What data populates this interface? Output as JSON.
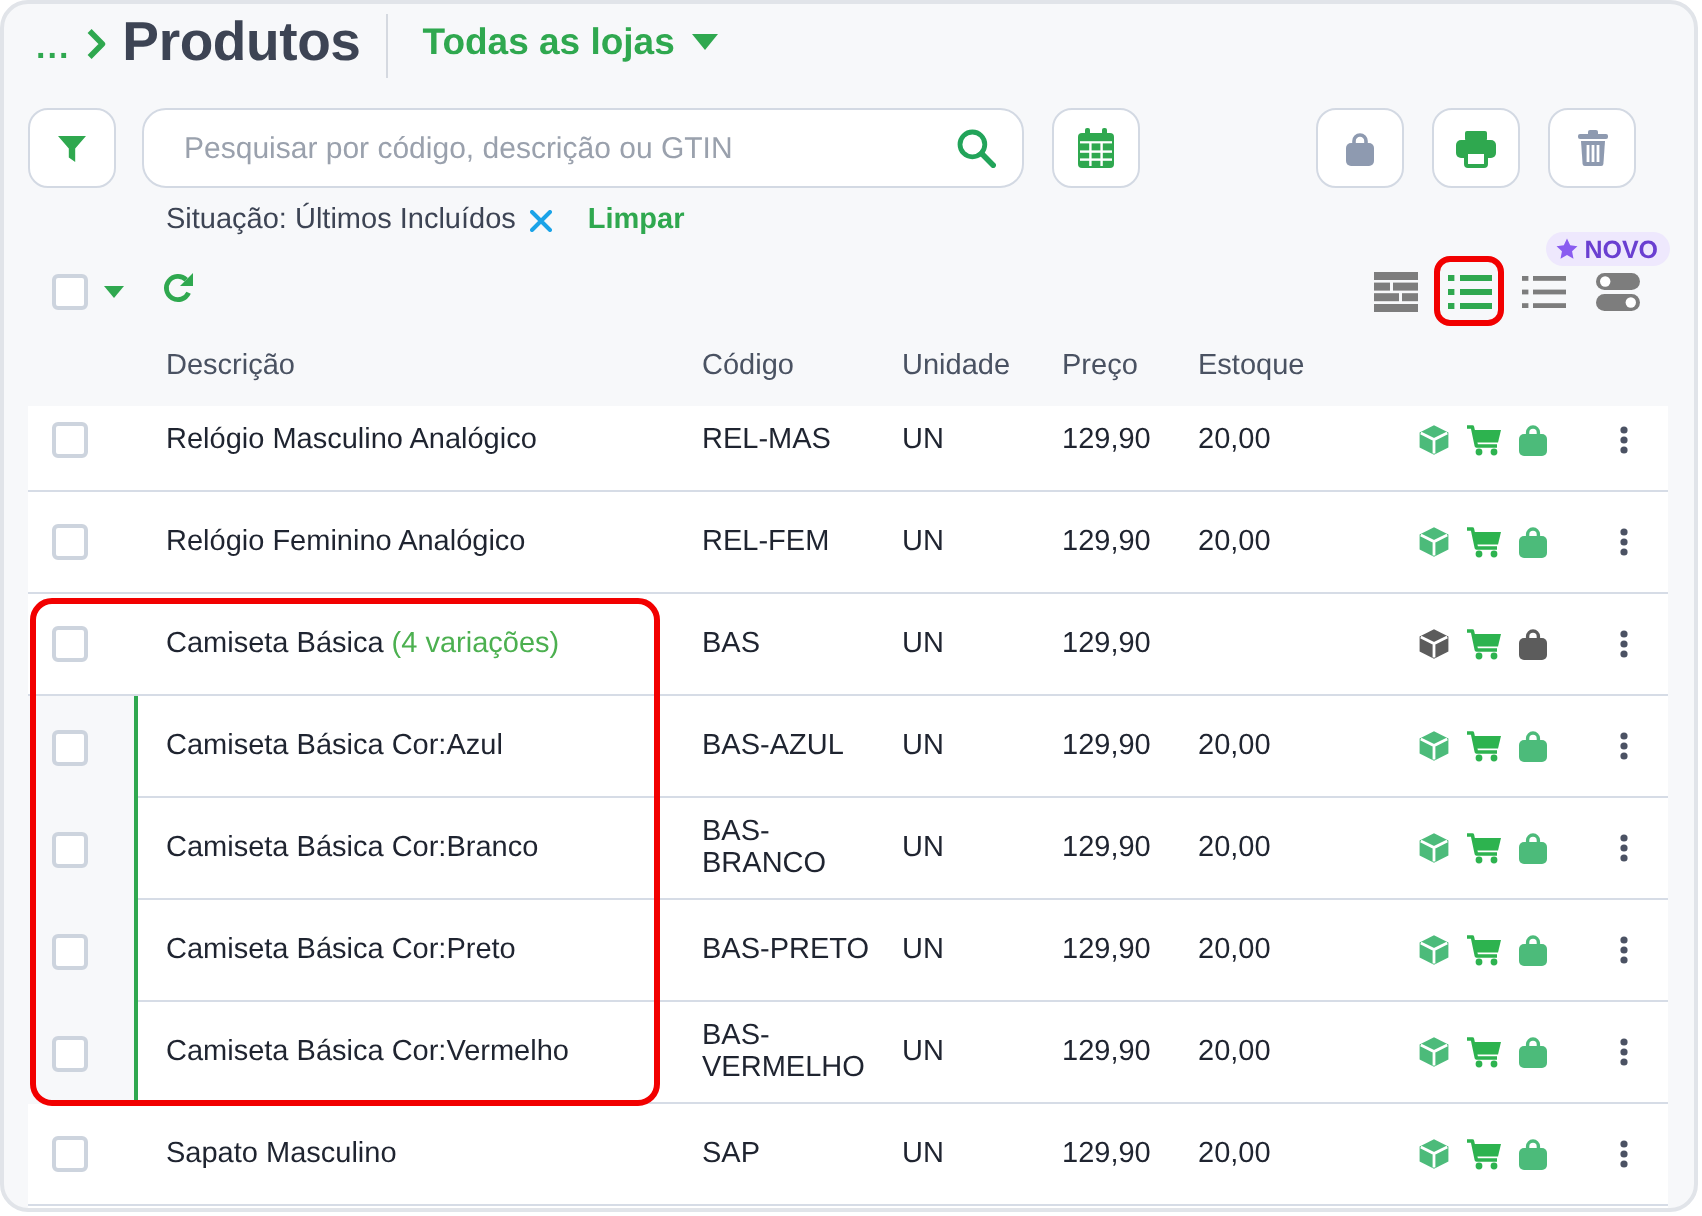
{
  "breadcrumb": {
    "ellipsis": "...",
    "title": "Produtos"
  },
  "store_selector": {
    "label": "Todas as lojas"
  },
  "search": {
    "placeholder": "Pesquisar por código, descrição ou GTIN"
  },
  "actions": [
    {
      "kind": "bag",
      "disabled": true
    },
    {
      "kind": "print",
      "disabled": false
    },
    {
      "kind": "trash",
      "disabled": true
    }
  ],
  "filters": {
    "chips": [
      {
        "label": "Situação: Últimos Incluídos"
      }
    ],
    "clear_label": "Limpar"
  },
  "select_all": {
    "checked": false
  },
  "view_modes": [
    {
      "kind": "table",
      "selected": false,
      "highlighted": false
    },
    {
      "kind": "bulleted_list",
      "selected": true,
      "highlighted": true
    },
    {
      "kind": "list",
      "selected": false,
      "highlighted": false
    },
    {
      "kind": "toggles",
      "selected": false,
      "highlighted": false,
      "badge": "NOVO"
    }
  ],
  "table": {
    "columns": [
      "Descrição",
      "Código",
      "Unidade",
      "Preço",
      "Estoque"
    ],
    "rows": [
      {
        "checked": false,
        "description": "Relógio Masculino Analógico",
        "code": "REL-MAS",
        "unit": "UN",
        "price": "129,90",
        "stock": "20,00",
        "cube_on": true,
        "cart_on": true,
        "bag_on": true
      },
      {
        "checked": false,
        "description": "Relógio Feminino Analógico",
        "code": "REL-FEM",
        "unit": "UN",
        "price": "129,90",
        "stock": "20,00",
        "cube_on": true,
        "cart_on": true,
        "bag_on": true
      },
      {
        "checked": false,
        "description": "Camiseta Básica",
        "variations_note": "(4 variações)",
        "code": "BAS",
        "unit": "UN",
        "price": "129,90",
        "cube_on": false,
        "cart_on": true,
        "bag_on": false,
        "highlighted": true,
        "children": [
          {
            "checked": false,
            "description": "Camiseta Básica Cor:Azul",
            "code": "BAS-AZUL",
            "unit": "UN",
            "price": "129,90",
            "stock": "20,00",
            "cube_on": true,
            "cart_on": true,
            "bag_on": true
          },
          {
            "checked": false,
            "description": "Camiseta Básica Cor:Branco",
            "code": "BAS-BRANCO",
            "unit": "UN",
            "price": "129,90",
            "stock": "20,00",
            "cube_on": true,
            "cart_on": true,
            "bag_on": true
          },
          {
            "checked": false,
            "description": "Camiseta Básica Cor:Preto",
            "code": "BAS-PRETO",
            "unit": "UN",
            "price": "129,90",
            "stock": "20,00",
            "cube_on": true,
            "cart_on": true,
            "bag_on": true
          },
          {
            "checked": false,
            "description": "Camiseta Básica Cor:Vermelho",
            "code": "BAS-VERMELHO",
            "unit": "UN",
            "price": "129,90",
            "stock": "20,00",
            "cube_on": true,
            "cart_on": true,
            "bag_on": true
          }
        ]
      },
      {
        "checked": false,
        "description": "Sapato Masculino",
        "code": "SAP",
        "unit": "UN",
        "price": "129,90",
        "stock": "20,00",
        "cube_on": true,
        "cart_on": true,
        "bag_on": true
      }
    ]
  }
}
